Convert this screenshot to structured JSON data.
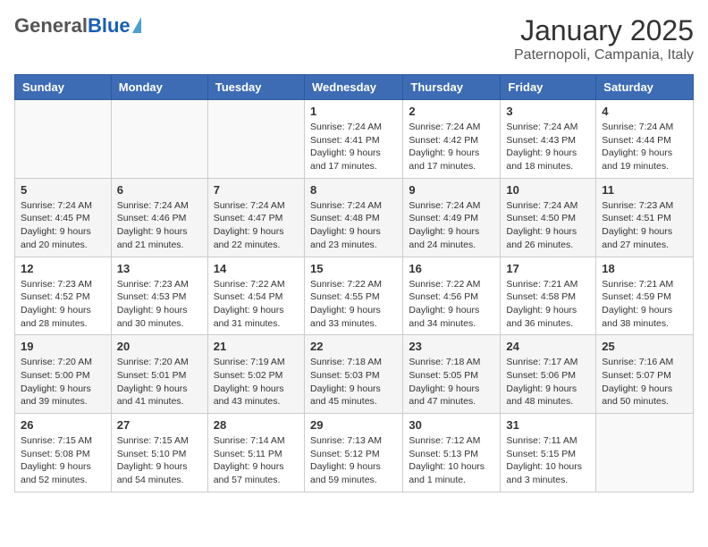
{
  "header": {
    "logo_general": "General",
    "logo_blue": "Blue",
    "month_title": "January 2025",
    "location": "Paternopoli, Campania, Italy"
  },
  "days_of_week": [
    "Sunday",
    "Monday",
    "Tuesday",
    "Wednesday",
    "Thursday",
    "Friday",
    "Saturday"
  ],
  "weeks": [
    [
      {
        "day": "",
        "info": ""
      },
      {
        "day": "",
        "info": ""
      },
      {
        "day": "",
        "info": ""
      },
      {
        "day": "1",
        "info": "Sunrise: 7:24 AM\nSunset: 4:41 PM\nDaylight: 9 hours\nand 17 minutes."
      },
      {
        "day": "2",
        "info": "Sunrise: 7:24 AM\nSunset: 4:42 PM\nDaylight: 9 hours\nand 17 minutes."
      },
      {
        "day": "3",
        "info": "Sunrise: 7:24 AM\nSunset: 4:43 PM\nDaylight: 9 hours\nand 18 minutes."
      },
      {
        "day": "4",
        "info": "Sunrise: 7:24 AM\nSunset: 4:44 PM\nDaylight: 9 hours\nand 19 minutes."
      }
    ],
    [
      {
        "day": "5",
        "info": "Sunrise: 7:24 AM\nSunset: 4:45 PM\nDaylight: 9 hours\nand 20 minutes."
      },
      {
        "day": "6",
        "info": "Sunrise: 7:24 AM\nSunset: 4:46 PM\nDaylight: 9 hours\nand 21 minutes."
      },
      {
        "day": "7",
        "info": "Sunrise: 7:24 AM\nSunset: 4:47 PM\nDaylight: 9 hours\nand 22 minutes."
      },
      {
        "day": "8",
        "info": "Sunrise: 7:24 AM\nSunset: 4:48 PM\nDaylight: 9 hours\nand 23 minutes."
      },
      {
        "day": "9",
        "info": "Sunrise: 7:24 AM\nSunset: 4:49 PM\nDaylight: 9 hours\nand 24 minutes."
      },
      {
        "day": "10",
        "info": "Sunrise: 7:24 AM\nSunset: 4:50 PM\nDaylight: 9 hours\nand 26 minutes."
      },
      {
        "day": "11",
        "info": "Sunrise: 7:23 AM\nSunset: 4:51 PM\nDaylight: 9 hours\nand 27 minutes."
      }
    ],
    [
      {
        "day": "12",
        "info": "Sunrise: 7:23 AM\nSunset: 4:52 PM\nDaylight: 9 hours\nand 28 minutes."
      },
      {
        "day": "13",
        "info": "Sunrise: 7:23 AM\nSunset: 4:53 PM\nDaylight: 9 hours\nand 30 minutes."
      },
      {
        "day": "14",
        "info": "Sunrise: 7:22 AM\nSunset: 4:54 PM\nDaylight: 9 hours\nand 31 minutes."
      },
      {
        "day": "15",
        "info": "Sunrise: 7:22 AM\nSunset: 4:55 PM\nDaylight: 9 hours\nand 33 minutes."
      },
      {
        "day": "16",
        "info": "Sunrise: 7:22 AM\nSunset: 4:56 PM\nDaylight: 9 hours\nand 34 minutes."
      },
      {
        "day": "17",
        "info": "Sunrise: 7:21 AM\nSunset: 4:58 PM\nDaylight: 9 hours\nand 36 minutes."
      },
      {
        "day": "18",
        "info": "Sunrise: 7:21 AM\nSunset: 4:59 PM\nDaylight: 9 hours\nand 38 minutes."
      }
    ],
    [
      {
        "day": "19",
        "info": "Sunrise: 7:20 AM\nSunset: 5:00 PM\nDaylight: 9 hours\nand 39 minutes."
      },
      {
        "day": "20",
        "info": "Sunrise: 7:20 AM\nSunset: 5:01 PM\nDaylight: 9 hours\nand 41 minutes."
      },
      {
        "day": "21",
        "info": "Sunrise: 7:19 AM\nSunset: 5:02 PM\nDaylight: 9 hours\nand 43 minutes."
      },
      {
        "day": "22",
        "info": "Sunrise: 7:18 AM\nSunset: 5:03 PM\nDaylight: 9 hours\nand 45 minutes."
      },
      {
        "day": "23",
        "info": "Sunrise: 7:18 AM\nSunset: 5:05 PM\nDaylight: 9 hours\nand 47 minutes."
      },
      {
        "day": "24",
        "info": "Sunrise: 7:17 AM\nSunset: 5:06 PM\nDaylight: 9 hours\nand 48 minutes."
      },
      {
        "day": "25",
        "info": "Sunrise: 7:16 AM\nSunset: 5:07 PM\nDaylight: 9 hours\nand 50 minutes."
      }
    ],
    [
      {
        "day": "26",
        "info": "Sunrise: 7:15 AM\nSunset: 5:08 PM\nDaylight: 9 hours\nand 52 minutes."
      },
      {
        "day": "27",
        "info": "Sunrise: 7:15 AM\nSunset: 5:10 PM\nDaylight: 9 hours\nand 54 minutes."
      },
      {
        "day": "28",
        "info": "Sunrise: 7:14 AM\nSunset: 5:11 PM\nDaylight: 9 hours\nand 57 minutes."
      },
      {
        "day": "29",
        "info": "Sunrise: 7:13 AM\nSunset: 5:12 PM\nDaylight: 9 hours\nand 59 minutes."
      },
      {
        "day": "30",
        "info": "Sunrise: 7:12 AM\nSunset: 5:13 PM\nDaylight: 10 hours\nand 1 minute."
      },
      {
        "day": "31",
        "info": "Sunrise: 7:11 AM\nSunset: 5:15 PM\nDaylight: 10 hours\nand 3 minutes."
      },
      {
        "day": "",
        "info": ""
      }
    ]
  ]
}
